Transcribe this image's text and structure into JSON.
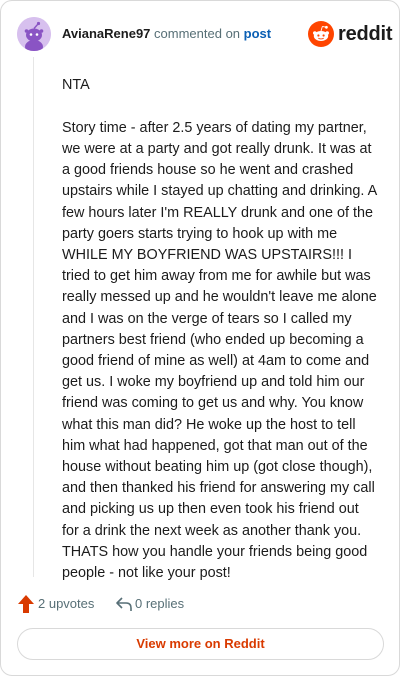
{
  "header": {
    "username": "AvianaRene97",
    "verb": "commented on",
    "post_link": "post",
    "brand": "reddit"
  },
  "comment": {
    "paragraphs": [
      "NTA",
      "Story time - after 2.5 years of dating my partner, we were at a party and got really drunk. It was at a good friends house so he went and crashed upstairs while I stayed up chatting and drinking. A few hours later I'm REALLY drunk and one of the party goers starts trying to hook up with me WHILE MY BOYFRIEND WAS UPSTAIRS!!! I tried to get him away from me for awhile but was really messed up and he wouldn't leave me alone and I was on the verge of tears so I called my partners best friend (who ended up becoming a good friend of mine as well) at 4am to come and get us. I woke my boyfriend up and told him our friend was coming to get us and why. You know what this man did? He woke up the host to tell him what had happened, got that man out of the house without beating him up (got close though), and then thanked his friend for answering my call and picking us up then even took his friend out for a drink the next week as another thank you. THATS how you handle your friends being good people - not like your post!"
    ]
  },
  "actions": {
    "upvotes": "2 upvotes",
    "replies": "0 replies"
  },
  "footer": {
    "view_more": "View more on Reddit"
  },
  "colors": {
    "upvote": "#d93a00",
    "brand": "#ff4500",
    "link": "#0a5fb4",
    "avatar_bg": "#d7c0ee"
  },
  "icons": {
    "avatar": "snoo-avatar-icon",
    "brand": "reddit-logo-icon",
    "upvote": "upvote-arrow-icon",
    "reply": "reply-arrow-icon"
  }
}
